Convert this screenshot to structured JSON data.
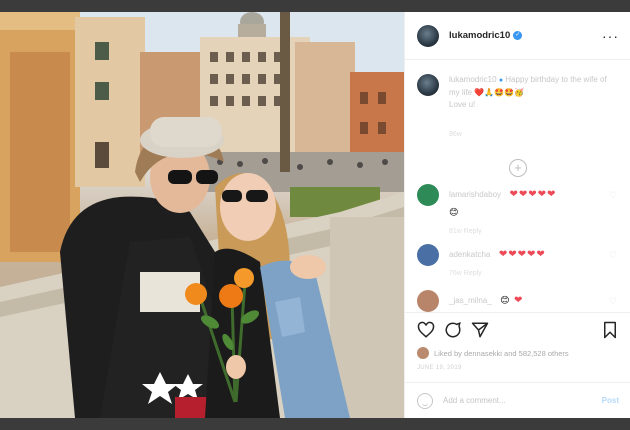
{
  "header": {
    "username": "lukamodric10",
    "verified": true,
    "more_icon": "more-horizontal-icon"
  },
  "caption": {
    "username": "lukamodric10",
    "text": "Happy birthday to the wife of my life",
    "text_end": "Love u!",
    "emojis": "❤️🙏🤩🤩🥳",
    "time": "86w"
  },
  "load_more_icon": "plus-circle-icon",
  "comments": [
    {
      "username": "lamarishdaboy",
      "hearts": "❤❤❤❤❤",
      "extra_emoji": "😊",
      "meta": "81w   Reply",
      "avatar_color": "#2e8b57"
    },
    {
      "username": "adenkatcha",
      "hearts": "❤❤❤❤❤",
      "extra_emoji": "",
      "meta": "76w   Reply",
      "avatar_color": "#4a6fa5"
    },
    {
      "username": "_jas_milna_",
      "hearts": "❤",
      "extra_emoji": "😊",
      "meta": "",
      "avatar_color": "#b9856a"
    }
  ],
  "actions": {
    "like_icon": "heart-icon",
    "comment_icon": "comment-icon",
    "share_icon": "share-icon",
    "save_icon": "bookmark-icon"
  },
  "likes_text": "Liked by dennasekki and 582,528 others",
  "post_date": "JUNE 19, 2019",
  "add_comment": {
    "placeholder": "Add a comment...",
    "post_label": "Post",
    "emoji_icon": "smiley-icon"
  },
  "colors": {
    "accent_blue": "#3897f0",
    "heart_red": "#ed4956",
    "post_disabled": "#b6dafb"
  }
}
